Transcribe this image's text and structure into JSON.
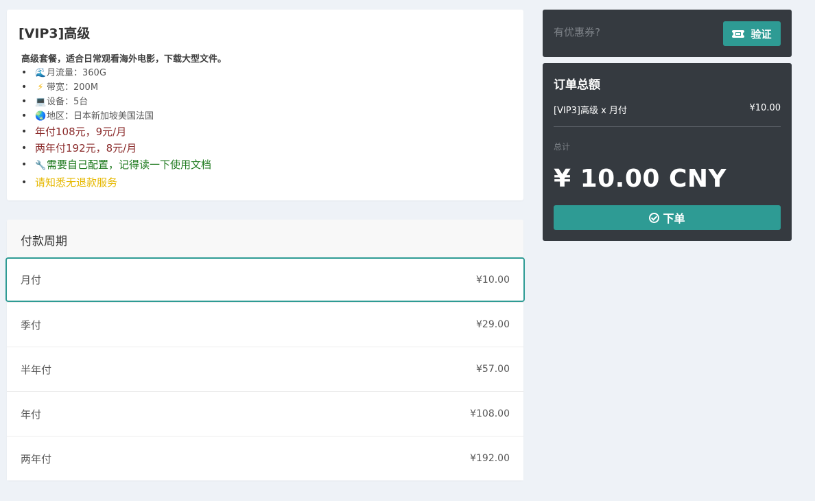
{
  "plan": {
    "title": "[VIP3]高级",
    "description": "高级套餐，适合日常观看海外电影，下载大型文件。",
    "features": [
      {
        "icon": "wave-icon",
        "text": "月流量：360G"
      },
      {
        "icon": "lightning-icon",
        "text": "带宽：200M"
      },
      {
        "icon": "laptop-icon",
        "text": "设备：5台"
      },
      {
        "icon": "globe-icon",
        "text": "地区：日本新加坡美国法国"
      }
    ],
    "notes": [
      {
        "text": "年付108元，9元/月",
        "color": "#8a2a2a"
      },
      {
        "text": "两年付192元，8元/月",
        "color": "#8a2a2a"
      },
      {
        "icon": "wrench-icon",
        "text": "需要自己配置，记得读一下使用文档",
        "color": "#1f7a1f"
      },
      {
        "text": "请知悉无退款服务",
        "color": "#e6b800"
      }
    ]
  },
  "billing": {
    "header": "付款周期",
    "selected_index": 0,
    "options": [
      {
        "label": "月付",
        "price": "¥10.00"
      },
      {
        "label": "季付",
        "price": "¥29.00"
      },
      {
        "label": "半年付",
        "price": "¥57.00"
      },
      {
        "label": "年付",
        "price": "¥108.00"
      },
      {
        "label": "两年付",
        "price": "¥192.00"
      }
    ]
  },
  "coupon": {
    "placeholder": "有优惠券?",
    "verify_label": "验证"
  },
  "summary": {
    "title": "订单总额",
    "item_label": "[VIP3]高级 x 月付",
    "item_price": "¥10.00",
    "total_label": "总计",
    "total_amount": "¥ 10.00 CNY",
    "order_button": "下单"
  },
  "colors": {
    "accent": "#2e9b94",
    "dark_panel": "#353a40",
    "background": "#eef2f7"
  }
}
